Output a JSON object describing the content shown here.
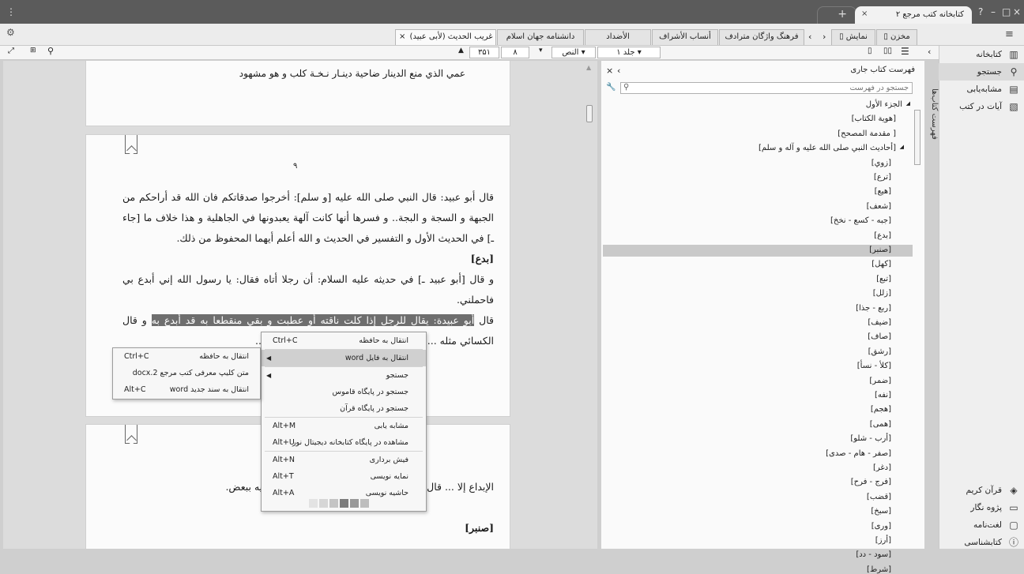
{
  "window": {
    "app_tab_title": "کتابخانه کتب مرجع ۲",
    "controls": [
      "?",
      "–",
      "□",
      "×"
    ]
  },
  "doc_tabs": [
    {
      "label": "غریب الحدیث (لأبی عبید)",
      "active": true
    },
    {
      "label": "دانشنامه جهان اسلام"
    },
    {
      "label": "الأضداد"
    },
    {
      "label": "أنساب الأشراف"
    },
    {
      "label": "فرهنگ واژگان مترادف"
    }
  ],
  "view_toggle": {
    "store": "مخزن",
    "display": "نمایش"
  },
  "toolbar": {
    "page_current": "۳۵۱",
    "page_part": "۸",
    "text_mode": "النص",
    "volume": "جلد ۱"
  },
  "pages": {
    "top_line": "عمي الذي منع الدينار ضاحية          دينـار نـخـة كلب و هو مشهود",
    "page_number": "۹",
    "p1": "قال أبو عبيد: قال النبي صلى الله عليه [و سلم]: أخرجوا صدقاتكم فان الله قد أراحكم من الجبهة و السجة و البجة.. و فسرها أنها كانت آلهة يعبدونها في الجاهلية و هذا خلاف ما [جاء ـ] في الحديث الأول و التفسير في الحديث و الله أعلم أيهما المحفوظ من ذلك.",
    "heading1": "[بدع]",
    "p2": "و قال [أبو عبيد ـ] في حديثه عليه السلام: أن رجلا أتاه فقال: يا رسول الله إني أبدع بي فاحملني.",
    "p3_pre": "قال ",
    "p3_hl": "أبو عبيدة: يقال للرجل إذا كلت ناقته أو عطبت و بقي منقطعا به قد أبدع به",
    "p3_post": " و قال الكسائي مثله ... أبدع به ... و قال بعض الأعراب لا يكون ...",
    "p4": "الإبداع إلا ... قال أبو عبيد: و هذا ليس باختلاف و بعضه شبيه ببعض.",
    "heading2": "[صنبر]"
  },
  "context_menu": {
    "items": [
      {
        "label": "انتقال به حافظه",
        "shortcut": "Ctrl+C"
      },
      {
        "label": "انتقال به فایل word",
        "submenu": true
      },
      {
        "label": "جستجو",
        "submenu": true
      },
      {
        "label": "جستجو در پایگاه قاموس"
      },
      {
        "label": "جستجو در پایگاه قرآن"
      },
      {
        "label": "مشابه یابی",
        "shortcut": "Alt+M"
      },
      {
        "label": "مشاهده در پایگاه کتابخانه دیجیتال نور",
        "shortcut": "Alt+U"
      },
      {
        "label": "فیش برداری",
        "shortcut": "Alt+N"
      },
      {
        "label": "نمایه نویسی",
        "shortcut": "Alt+T"
      },
      {
        "label": "حاشیه نویسی",
        "shortcut": "Alt+A"
      }
    ],
    "swatches": [
      "#e3e3e3",
      "#d6d6d6",
      "#c4c4c4",
      "#7c7c7c",
      "#989898",
      "#bdbdbd"
    ]
  },
  "submenu": {
    "items": [
      {
        "label": "انتقال به حافظه",
        "shortcut": "Ctrl+C"
      },
      {
        "label": "متن کلیپ معرفی کتب مرجع docx.2"
      },
      {
        "label": "انتقال به سند جدید word",
        "shortcut": "Alt+C"
      }
    ]
  },
  "toc": {
    "title": "فهرست کتاب جاری",
    "search_placeholder": "جستجو در فهرست",
    "vertical_label": "فهرست کتاب‌ها",
    "items": [
      {
        "label": "الجزء الأول",
        "level": 0,
        "expanded": true
      },
      {
        "label": "[هوية الكتاب]",
        "level": 1
      },
      {
        "label": "[ مقدمة المصحح]",
        "level": 1
      },
      {
        "label": "[أحاديث النبي صلى الله عليه و آله و سلم]",
        "level": 1,
        "expanded": true
      },
      {
        "label": "[زوي]",
        "level": 2
      },
      {
        "label": "[ترع]",
        "level": 2
      },
      {
        "label": "[هيع]",
        "level": 2
      },
      {
        "label": "[شعف]",
        "level": 2
      },
      {
        "label": "[جبه - كسع - نخخ]",
        "level": 2
      },
      {
        "label": "[بدع]",
        "level": 2
      },
      {
        "label": "[صنبر]",
        "level": 2,
        "selected": true
      },
      {
        "label": "[كهل]",
        "level": 2
      },
      {
        "label": "[تبع]",
        "level": 2
      },
      {
        "label": "[زلل]",
        "level": 2
      },
      {
        "label": "[ربع - جذا]",
        "level": 2
      },
      {
        "label": "[ضيف]",
        "level": 2
      },
      {
        "label": "[صاف]",
        "level": 2
      },
      {
        "label": "[رشق]",
        "level": 2
      },
      {
        "label": "[كلأ - نسأ]",
        "level": 2
      },
      {
        "label": "[ضمر]",
        "level": 2
      },
      {
        "label": "[نفه]",
        "level": 2
      },
      {
        "label": "[هجم]",
        "level": 2
      },
      {
        "label": "[همى]",
        "level": 2
      },
      {
        "label": "[أرب - شلو]",
        "level": 2
      },
      {
        "label": "[صفر - هام - صدى]",
        "level": 2
      },
      {
        "label": "[دغر]",
        "level": 2
      },
      {
        "label": "[فرج - فرح]",
        "level": 2
      },
      {
        "label": "[قضب]",
        "level": 2
      },
      {
        "label": "[سبخ]",
        "level": 2
      },
      {
        "label": "[ورى]",
        "level": 2
      },
      {
        "label": "[أرز]",
        "level": 2
      },
      {
        "label": "[سود - دد]",
        "level": 2
      },
      {
        "label": "[شرط]",
        "level": 2
      }
    ]
  },
  "sidebar": {
    "top": [
      {
        "label": "کتابخانه",
        "icon": "library-icon"
      },
      {
        "label": "جستجو",
        "icon": "search-icon",
        "active": true
      },
      {
        "label": "مشابه‌یابی",
        "icon": "similar-icon"
      },
      {
        "label": "آیات در کتب",
        "icon": "verses-icon"
      }
    ],
    "bottom": [
      {
        "label": "قرآن کریم",
        "icon": "quran-icon"
      },
      {
        "label": "پژوه نگار",
        "icon": "research-icon"
      },
      {
        "label": "لغت‌نامه",
        "icon": "dictionary-icon"
      },
      {
        "label": "کتابشناسی",
        "icon": "bibliography-icon"
      }
    ]
  }
}
